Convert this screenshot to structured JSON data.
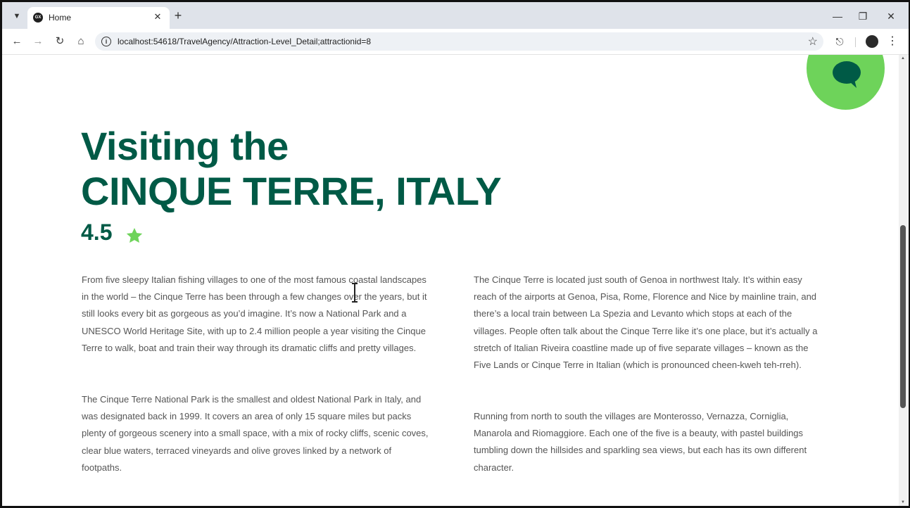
{
  "browser": {
    "tab_title": "Home",
    "favicon_text": "GX",
    "url": "localhost:54618/TravelAgency/Attraction-Level_Detail;attractionid=8"
  },
  "page": {
    "heading_line1": "Visiting the",
    "heading_line2": "CINQUE TERRE, ITALY",
    "rating": "4.5",
    "accent_color": "#005a46",
    "star_color": "#6ed35a",
    "paragraphs": [
      "From five sleepy Italian fishing villages to one of the most famous coastal landscapes in the world – the Cinque Terre has been through a few changes over the years, but it still looks every bit as gorgeous as you’d imagine. It’s now a National Park and a UNESCO World Heritage Site, with up to 2.4 million people a year visiting the Cinque Terre to walk, boat and train their way through its dramatic cliffs and pretty villages.",
      "The Cinque Terre National Park is the smallest and oldest National Park in Italy, and was designated back in 1999. It covers an area of only 15 square miles but packs plenty of gorgeous scenery into a small space, with a mix of rocky cliffs, scenic coves, clear blue waters, terraced vineyards and olive groves linked by a network of footpaths.",
      "The Cinque Terre is located just south of Genoa in northwest Italy. It’s within easy reach of the airports at Genoa, Pisa, Rome, Florence and Nice by mainline train, and there’s a local train between La Spezia and Levanto which stops at each of the villages. People often talk about the Cinque Terre like it’s one place, but it’s actually a stretch of Italian Riveira coastline made up of five separate villages – known as the Five Lands or Cinque Terre in Italian (which is pronounced cheen-kweh teh-rreh).",
      "Running from north to south the villages are Monterosso, Vernazza, Corniglia, Manarola and Riomaggiore. Each one of the five is a beauty, with pastel buildings tumbling down the hillsides and sparkling sea views, but each has its own different character."
    ]
  }
}
